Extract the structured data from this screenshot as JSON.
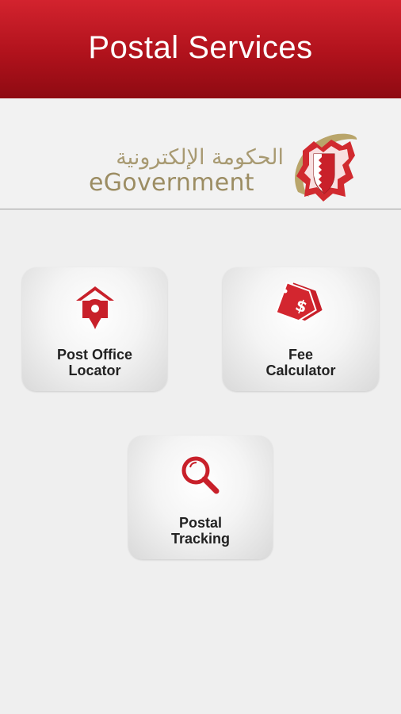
{
  "header": {
    "title": "Postal Services"
  },
  "brand": {
    "arabic": "الحكومة الإلكترونية",
    "english": "eGovernment",
    "emblem_icon": "bahrain-emblem-icon"
  },
  "tiles": [
    {
      "line1": "Post Office",
      "line2": "Locator",
      "icon": "post-office-location-icon"
    },
    {
      "line1": "Fee",
      "line2": "Calculator",
      "icon": "price-tag-icon"
    },
    {
      "line1": "Postal",
      "line2": "Tracking",
      "icon": "magnifier-icon"
    }
  ],
  "colors": {
    "header_red": "#b0121c",
    "icon_red": "#c8202a",
    "brand_gold": "#9c8d63",
    "background": "#efefef"
  }
}
